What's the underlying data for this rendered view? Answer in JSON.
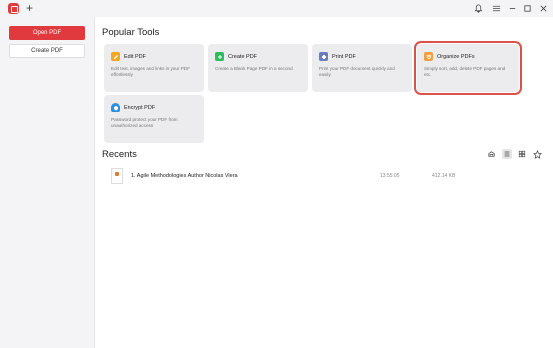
{
  "titlebar": {
    "new_tab": "+"
  },
  "sidebar": {
    "open_pdf": "Open PDF",
    "create_pdf": "Create PDF"
  },
  "popular_tools": {
    "title": "Popular Tools",
    "tools": [
      {
        "name": "Edit PDF",
        "desc": "Edit text, images and links in your PDF effortlessly",
        "icon": "edit-icon",
        "color": "#f5a623"
      },
      {
        "name": "Create PDF",
        "desc": "Create a Blank Page PDF in a second",
        "icon": "create-icon",
        "color": "#2ebc5f"
      },
      {
        "name": "Print PDF",
        "desc": "Print your PDF document quickly and easily",
        "icon": "print-icon",
        "color": "#6a7bbf"
      },
      {
        "name": "Organize PDFs",
        "desc": "Simply sort, add, delete PDF pages and etc.",
        "icon": "organize-icon",
        "color": "#f0a040",
        "selected": true
      },
      {
        "name": "Encrypt PDF",
        "desc": "Password protect your PDF from unauthorized access",
        "icon": "encrypt-icon",
        "color": "#2d8fe0"
      }
    ]
  },
  "recents": {
    "title": "Recents",
    "files": [
      {
        "name": "1. Agile Methodologies Author Nicolas Viera",
        "time": "13:55:05",
        "size": "412.14 KB"
      }
    ]
  },
  "colors": {
    "accent": "#e0393e",
    "highlight_outline": "#d9534a"
  }
}
